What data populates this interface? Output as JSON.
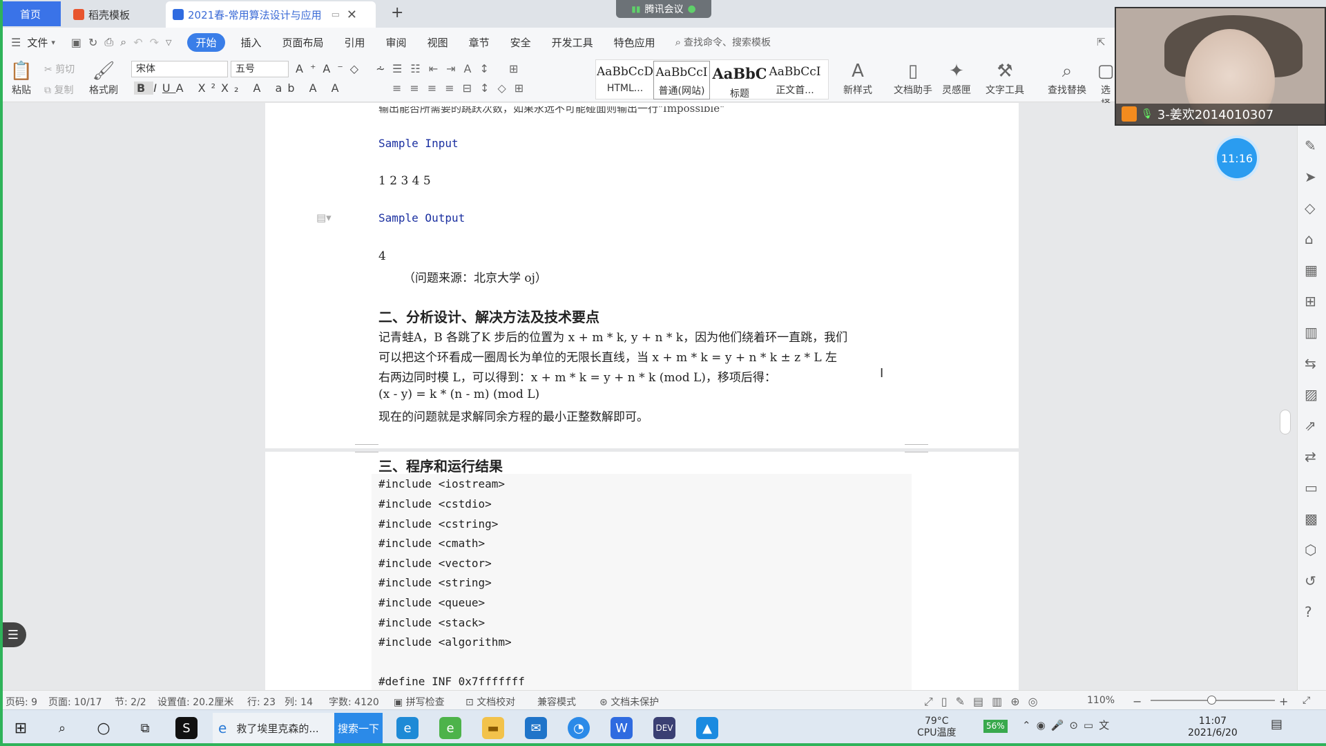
{
  "tabs": {
    "home": "首页",
    "template": "稻壳模板",
    "document": "2021春-常用算法设计与应用",
    "new_tab": "+"
  },
  "meeting": {
    "label": "腾讯会议"
  },
  "menu": {
    "file": "文件",
    "items": [
      "开始",
      "插入",
      "页面布局",
      "引用",
      "审阅",
      "视图",
      "章节",
      "安全",
      "开发工具",
      "特色应用"
    ],
    "search_placeholder": "查找命令、搜索模板"
  },
  "ribbon": {
    "paste": "粘贴",
    "cut": "剪切",
    "copy": "复制",
    "format_painter": "格式刷",
    "font_name": "宋体",
    "font_size": "五号",
    "styles": [
      {
        "preview": "AaBbCcDc",
        "label": "HTML..."
      },
      {
        "preview": "AaBbCcI",
        "label": "普通(网站)"
      },
      {
        "preview": "AaBbC",
        "label": "标题"
      },
      {
        "preview": "AaBbCcI",
        "label": "正文首..."
      }
    ],
    "new_style": "新样式",
    "doc_assistant": "文档助手",
    "inspiration": "灵感匣",
    "text_tools": "文字工具",
    "find_replace": "查找替换",
    "select": "选择"
  },
  "video": {
    "participant": "3-姜欢2014010307"
  },
  "timer": "11:16",
  "document": {
    "top_cut_text": "输出能否所需要的跳跃次数，如果永远不可能碰面则输出一行\"Impossible\"",
    "sample_input_label": "Sample Input",
    "sample_input": "1 2 3 4 5",
    "sample_output_label": "Sample Output",
    "sample_output": "4",
    "source": "（问题来源：北京大学 oj）",
    "section2_title": "二、分析设计、解决方法及技术要点",
    "section2_lines": [
      "记青蛙A，B 各跳了K 步后的位置为 x + m * k, y + n * k，因为他们绕着环一直跳，我们",
      "可以把这个环看成一圈周长为单位的无限长直线，当 x + m * k = y + n * k ± z * L 左",
      "右两边同时模 L，可以得到：x + m * k = y + n * k (mod L)，移项后得：",
      "(x - y) = k * (n - m) (mod L)",
      "现在的问题就是求解同余方程的最小正整数解即可。"
    ],
    "section3_title": "三、程序和运行结果",
    "code_lines": [
      "#include <iostream>",
      "#include <cstdio>",
      "#include <cstring>",
      "#include <cmath>",
      "#include <vector>",
      "#include <string>",
      "#include <queue>",
      "#include <stack>",
      "#include <algorithm>",
      "",
      "#define INF 0x7fffffff"
    ]
  },
  "status": {
    "page_code": "页码: 9",
    "page": "页面: 10/17",
    "section": "节: 2/2",
    "setting": "设置值: 20.2厘米",
    "line": "行: 23",
    "column": "列: 14",
    "word_count": "字数: 4120",
    "spell_check": "拼写检查",
    "doc_proof": "文档校对",
    "compat_mode": "兼容模式",
    "unprotected": "文档未保护",
    "zoom": "110%"
  },
  "taskbar": {
    "browser_tab": "救了埃里克森的...",
    "search_button": "搜索一下",
    "temperature": "79°C",
    "cpu_label": "CPU温度",
    "battery": "56%",
    "time": "11:07",
    "date": "2021/6/20"
  },
  "colors": {
    "accent": "#3a7ee8",
    "home_tab": "#3a73e8",
    "sample_label": "#1a2fa0",
    "timer": "#2a9cf0"
  }
}
